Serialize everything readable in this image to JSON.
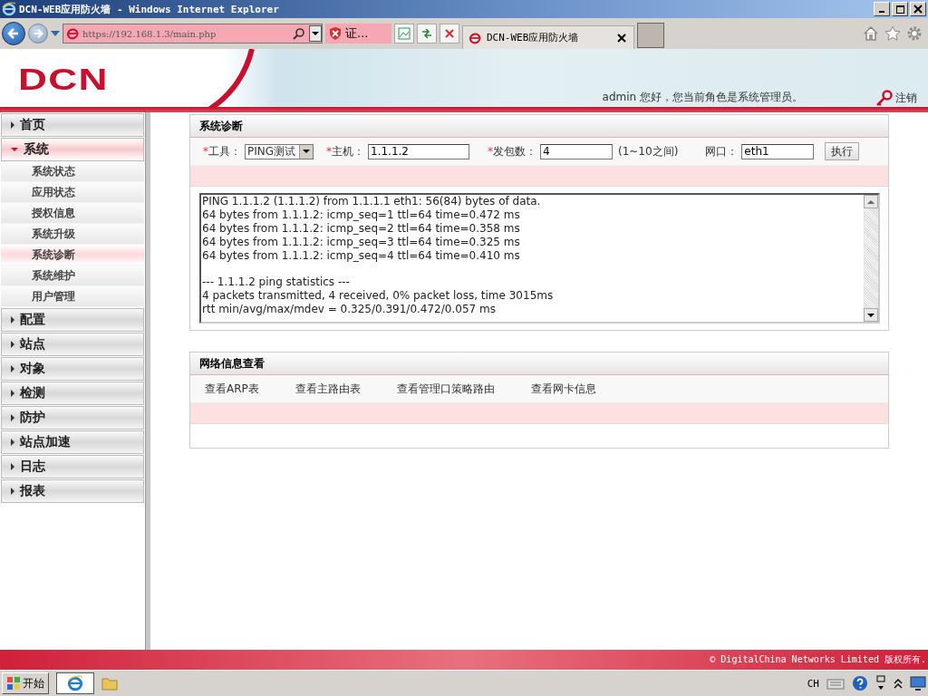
{
  "window": {
    "title": "DCN-WEB应用防火墙 - Windows Internet Explorer"
  },
  "browser": {
    "address": "https://192.168.1.3/main.php",
    "cert_label": "证...",
    "tab_title": "DCN-WEB应用防火墙"
  },
  "header": {
    "logo": "DCN",
    "greeting": "admin 您好，您当前角色是系统管理员。",
    "logout": "注销"
  },
  "sidebar": {
    "items": [
      {
        "label": "首页",
        "expanded": false
      },
      {
        "label": "系统",
        "expanded": true,
        "children": [
          {
            "label": "系统状态",
            "selected": false
          },
          {
            "label": "应用状态",
            "selected": false
          },
          {
            "label": "授权信息",
            "selected": false
          },
          {
            "label": "系统升级",
            "selected": false
          },
          {
            "label": "系统诊断",
            "selected": true
          },
          {
            "label": "系统维护",
            "selected": false
          },
          {
            "label": "用户管理",
            "selected": false
          }
        ]
      },
      {
        "label": "配置",
        "expanded": false
      },
      {
        "label": "站点",
        "expanded": false
      },
      {
        "label": "对象",
        "expanded": false
      },
      {
        "label": "检测",
        "expanded": false
      },
      {
        "label": "防护",
        "expanded": false
      },
      {
        "label": "站点加速",
        "expanded": false
      },
      {
        "label": "日志",
        "expanded": false
      },
      {
        "label": "报表",
        "expanded": false
      }
    ]
  },
  "diagnostics": {
    "title": "系统诊断",
    "tool": {
      "required_mark": "*",
      "label": "工具：",
      "value": "PING测试"
    },
    "host": {
      "required_mark": "*",
      "label": "主机：",
      "value": "1.1.1.2"
    },
    "count": {
      "required_mark": "*",
      "label": "发包数：",
      "value": "4",
      "hint": "(1~10之间)"
    },
    "port": {
      "label": "网口：",
      "value": "eth1"
    },
    "run_button": "执行",
    "output": [
      [
        "PING 1.1.1.2 (1.1.1.2) from 1.1.1.1 eth1: 56(84) bytes of data.",
        "64 bytes from 1.1.1.2: icmp_seq=1 ttl=64 time=0.472 ms",
        "64 bytes from 1.1.1.2: icmp_seq=2 ttl=64 time=0.358 ms",
        "64 bytes from 1.1.1.2: icmp_seq=3 ttl=64 time=0.325 ms",
        "64 bytes from 1.1.1.2: icmp_seq=4 ttl=64 time=0.410 ms"
      ],
      [
        "--- 1.1.1.2 ping statistics ---",
        "4 packets transmitted, 4 received, 0% packet loss, time 3015ms",
        "rtt min/avg/max/mdev = 0.325/0.391/0.472/0.057 ms"
      ]
    ]
  },
  "network_info": {
    "title": "网络信息查看",
    "links": [
      "查看ARP表",
      "查看主路由表",
      "查看管理口策略路由",
      "查看网卡信息"
    ]
  },
  "footer": {
    "copyright": "© DigitalChina Networks Limited 版权所有."
  },
  "taskbar": {
    "start": "开始",
    "language": "CH"
  }
}
